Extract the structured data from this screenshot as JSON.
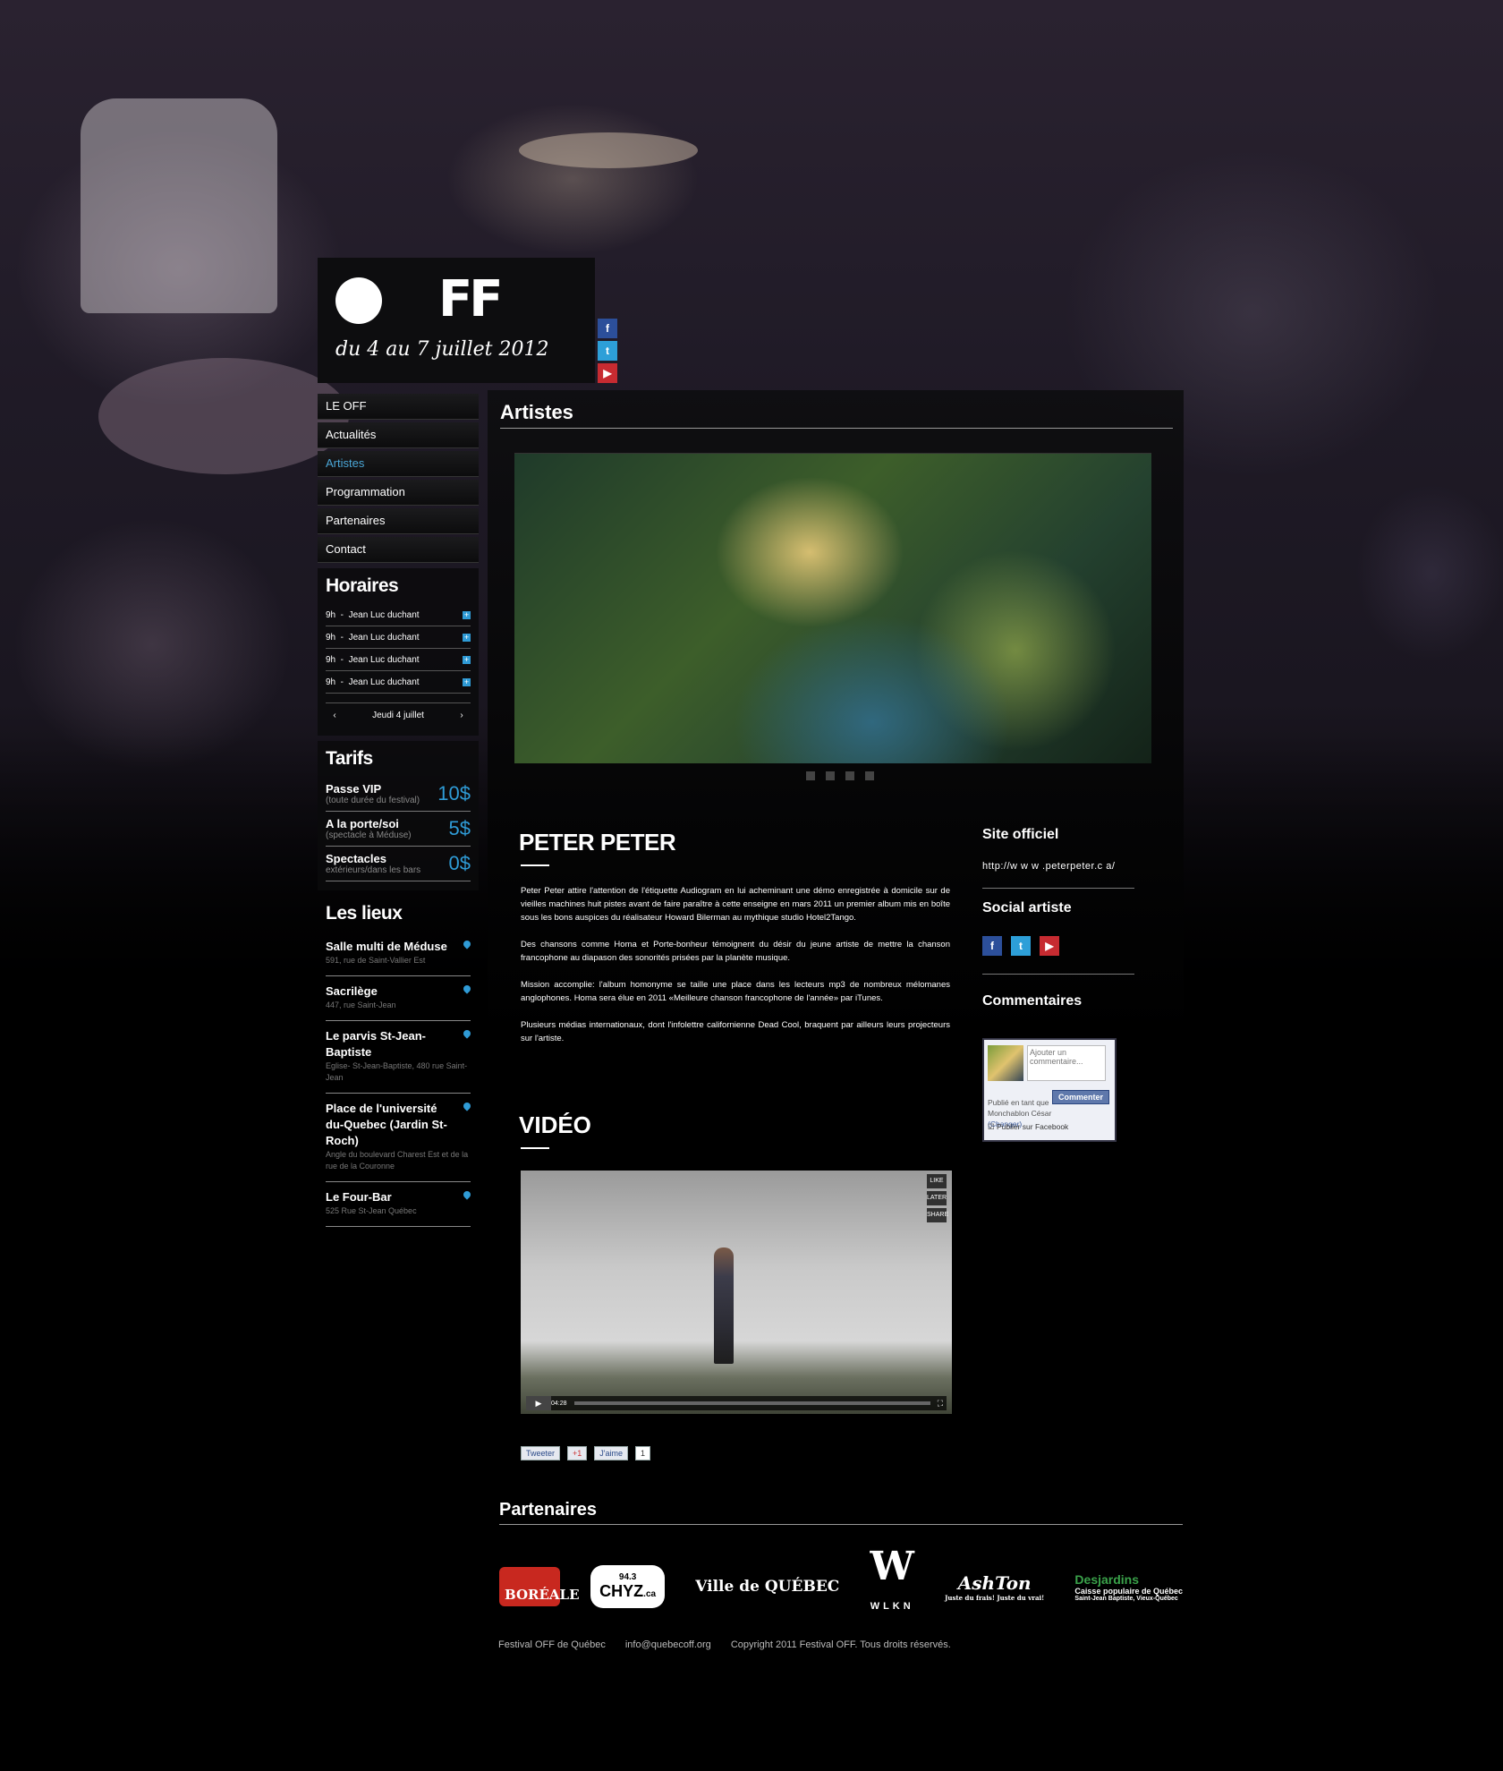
{
  "header": {
    "logo_text": "FF",
    "dates": "du 4 au 7 juillet 2012",
    "social": [
      {
        "name": "facebook",
        "glyph": "f"
      },
      {
        "name": "twitter",
        "glyph": "t"
      },
      {
        "name": "youtube",
        "glyph": "▶"
      }
    ]
  },
  "nav": {
    "items": [
      "LE OFF",
      "Actualités",
      "Artistes",
      "Programmation",
      "Partenaires",
      "Contact"
    ],
    "active_index": 2
  },
  "horaires": {
    "title": "Horaires",
    "rows": [
      {
        "time": "9h",
        "artist": "Jean Luc duchant"
      },
      {
        "time": "9h",
        "artist": "Jean Luc duchant"
      },
      {
        "time": "9h",
        "artist": "Jean Luc duchant"
      },
      {
        "time": "9h",
        "artist": "Jean Luc duchant"
      }
    ],
    "day_label": "Jeudi 4 juillet",
    "prev": "‹",
    "next": "›"
  },
  "tarifs": {
    "title": "Tarifs",
    "items": [
      {
        "name": "Passe VIP",
        "sub": "(toute durée du festival)",
        "price": "10$"
      },
      {
        "name": "A la porte/soi",
        "sub": "(spectacle à Méduse)",
        "price": "5$"
      },
      {
        "name": "Spectacles",
        "sub": "extérieurs/dans les bars",
        "price": "0$"
      }
    ]
  },
  "lieux": {
    "title": "Les lieux",
    "items": [
      {
        "name": "Salle multi de Méduse",
        "addr": "591, rue de Saint-Vallier Est"
      },
      {
        "name": "Sacrilège",
        "addr": "447, rue Saint-Jean"
      },
      {
        "name": "Le parvis St-Jean-Baptiste",
        "addr": "Eglise- St-Jean-Baptiste, 480 rue Saint-Jean"
      },
      {
        "name": "Place de l'université du-Quebec (Jardin St-Roch)",
        "addr": "Angle du boulevard Charest Est et de la rue de la Couronne"
      },
      {
        "name": "Le Four-Bar",
        "addr": "525 Rue St-Jean Québec"
      }
    ]
  },
  "main": {
    "title": "Artistes",
    "artist_name": "PETER PETER",
    "bio": [
      "Peter Peter attire l'attention de l'étiquette Audiogram en lui acheminant une démo enregistrée à domicile sur de vieilles machines huit pistes avant de faire paraître à cette enseigne en mars 2011 un premier album mis en boîte sous les bons auspices du réalisateur Howard Bilerman au mythique studio Hotel2Tango.",
      "Des chansons comme Homa et Porte-bonheur témoignent du désir du jeune artiste de mettre la chanson francophone au diapason des sonorités prisées par la planète musique.",
      "Mission accomplie: l'album homonyme se taille une place dans les lecteurs mp3 de nombreux mélomanes anglophones. Homa sera élue en 2011 «Meilleure chanson francophone de l'année» par iTunes.",
      "Plusieurs médias internationaux, dont l'infolettre californienne Dead Cool, braquent par ailleurs leurs projecteurs sur l'artiste."
    ],
    "video_title": "VIDÉO",
    "video_time": "04:28",
    "video_side": [
      "LIKE",
      "LATER",
      "SHARE"
    ],
    "share": {
      "tweet": "Tweeter",
      "gplus": "+1",
      "like": "J'aime",
      "like_count": "1"
    },
    "site": {
      "title": "Site officiel",
      "url": "http://w w w .peterpeter.c a/"
    },
    "social_title": "Social artiste",
    "comments": {
      "title": "Commentaires",
      "placeholder": "Ajouter un commentaire...",
      "button": "Commenter",
      "published_as": "Publié en tant que Monchablon César",
      "change": "(Changer)",
      "post_fb": "Publier sur Facebook"
    }
  },
  "partners": {
    "title": "Partenaires",
    "logos": [
      "BORÉALE",
      "CHYZ",
      "Ville de QUÉBEC",
      "WLKN",
      "AshTon",
      "Desjardins"
    ],
    "chyz_freq": "94.3",
    "chyz_suffix": ".ca",
    "ashton_tag": "Juste du frais! Juste du vrai!",
    "desj_sub": "Caisse populaire de Québec",
    "desj_place": "Saint-Jean Baptiste, Vieux-Québec"
  },
  "footer": {
    "org": "Festival OFF de Québec",
    "email": "info@quebecoff.org",
    "copyright": "Copyright 2011 Festival OFF. Tous droits réservés."
  }
}
